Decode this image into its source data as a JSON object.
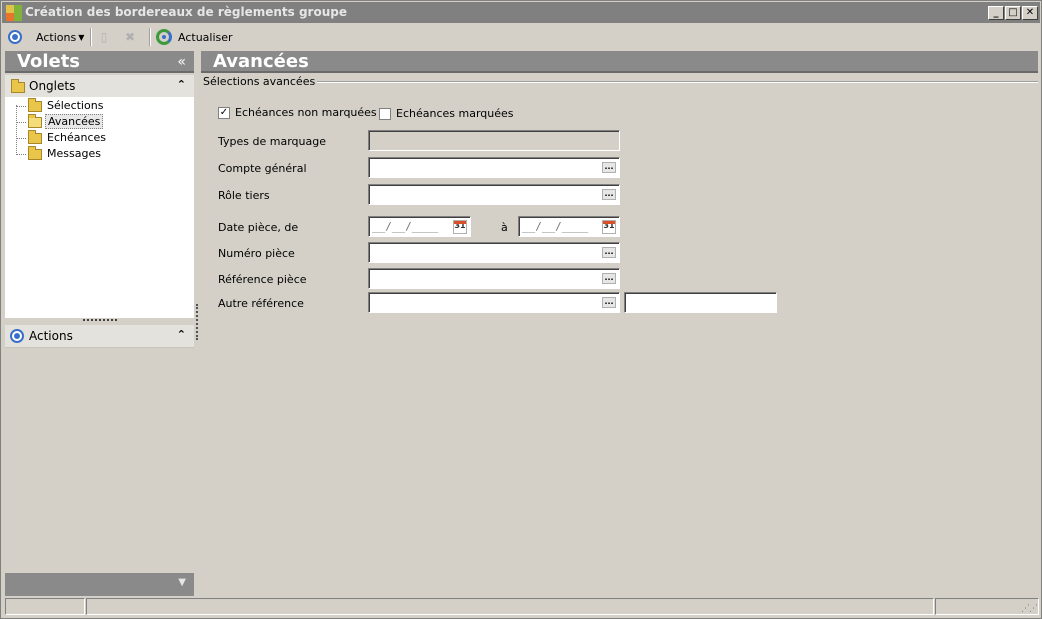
{
  "window": {
    "title": "Création des bordereaux de règlements groupe"
  },
  "toolbar": {
    "actions_label": "Actions",
    "refresh_label": "Actualiser"
  },
  "left_pane": {
    "title": "Volets",
    "onglets_label": "Onglets",
    "tree_items": [
      "Sélections",
      "Avancées",
      "Echéances",
      "Messages"
    ],
    "selected_index": 1,
    "actions_label": "Actions"
  },
  "main": {
    "title": "Avancées",
    "section_title": "Sélections avancées",
    "checkbox_non_marquees": {
      "label": "Echéances non marquées",
      "checked": true
    },
    "checkbox_marquees": {
      "label": "Echéances marquées",
      "checked": false
    },
    "fields": {
      "types_marquage": "Types de marquage",
      "compte_general": "Compte général",
      "role_tiers": "Rôle tiers",
      "date_piece_de": "Date pièce, de",
      "date_a": "à",
      "numero_piece": "Numéro pièce",
      "reference_piece": "Référence pièce",
      "autre_reference": "Autre référence"
    },
    "date_placeholder": "__/__/____",
    "calendar_day": "31",
    "ellipsis": "..."
  }
}
